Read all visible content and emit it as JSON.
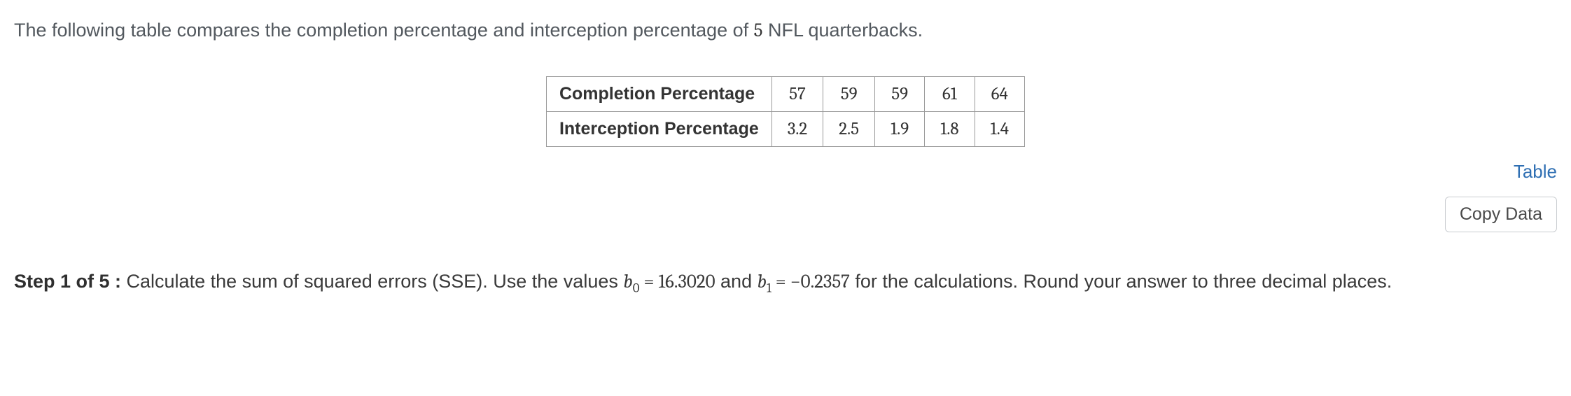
{
  "intro_prefix": "The following table compares the completion percentage and interception percentage of ",
  "intro_count": "5",
  "intro_suffix": " NFL quarterbacks.",
  "table": {
    "row1_label": "Completion Percentage",
    "row2_label": "Interception Percentage"
  },
  "chart_data": {
    "type": "table",
    "headers": [
      "Completion Percentage",
      "Interception Percentage"
    ],
    "rows": [
      {
        "completion": 57,
        "interception": 3.2
      },
      {
        "completion": 59,
        "interception": 2.5
      },
      {
        "completion": 59,
        "interception": 1.9
      },
      {
        "completion": 61,
        "interception": 1.8
      },
      {
        "completion": 64,
        "interception": 1.4
      }
    ]
  },
  "actions": {
    "table_link": "Table",
    "copy_button": "Copy Data"
  },
  "step": {
    "label": "Step 1 of 5 :",
    "text_before_b0": "  Calculate the sum of squared errors (SSE). Use the values ",
    "b0_sym": "b",
    "b0_sub": "0",
    "eq": " = ",
    "b0_val": "16.3020",
    "and": " and ",
    "b1_sym": "b",
    "b1_sub": "1",
    "b1_val": "−0.2357",
    "text_after": " for the calculations. Round your answer to three decimal places."
  }
}
